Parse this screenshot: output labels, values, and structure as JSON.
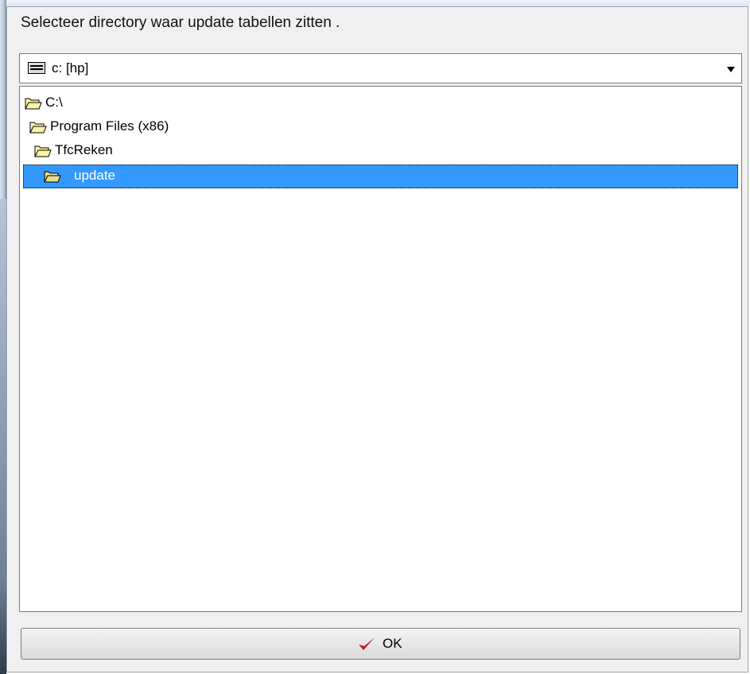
{
  "dialog": {
    "caption": "Selecteer directory waar update tabellen zitten ."
  },
  "drive_combo": {
    "value": "c: [hp]",
    "icon": "drive-icon"
  },
  "tree": {
    "items": [
      {
        "label": "C:\\",
        "icon": "folder-open-icon",
        "level": 0,
        "selected": false
      },
      {
        "label": "Program Files (x86)",
        "icon": "folder-open-icon",
        "level": 1,
        "selected": false
      },
      {
        "label": "TfcReken",
        "icon": "folder-open-icon",
        "level": 2,
        "selected": false
      },
      {
        "label": "update",
        "icon": "folder-open-icon",
        "level": 3,
        "selected": true
      }
    ]
  },
  "ok_button": {
    "label": "OK",
    "icon": "checkmark-icon"
  },
  "colors": {
    "selection": "#3399ff",
    "folder_fill": "#fff3a8",
    "checkmark": "#c8102e"
  }
}
